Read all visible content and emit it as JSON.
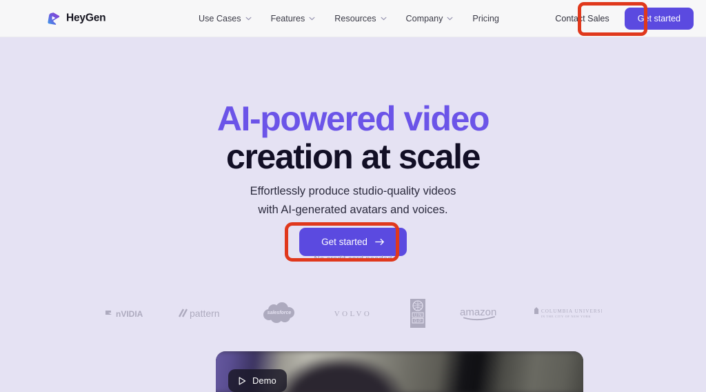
{
  "header": {
    "logo_text": "HeyGen",
    "logo_icon": "heygen-play-logo-icon",
    "nav_items": [
      {
        "label": "Use Cases",
        "has_chevron": true,
        "icon": "chevron-down-icon"
      },
      {
        "label": "Features",
        "has_chevron": true,
        "icon": "chevron-down-icon"
      },
      {
        "label": "Resources",
        "has_chevron": true,
        "icon": "chevron-down-icon"
      },
      {
        "label": "Company",
        "has_chevron": true,
        "icon": "chevron-down-icon"
      },
      {
        "label": "Pricing",
        "has_chevron": false,
        "icon": ""
      }
    ],
    "contact_sales_label": "Contact Sales",
    "cta_label": "Get started"
  },
  "hero": {
    "headline_line1": "AI-powered video",
    "headline_line2": "creation at scale",
    "subhead_line1": "Effortlessly produce studio-quality videos",
    "subhead_line2": "with AI-generated avatars and voices.",
    "cta_label": "Get started",
    "cta_icon": "arrow-right-icon",
    "no_card_note": "No credit card needed"
  },
  "logo_strip": {
    "brands": [
      {
        "name": "nvidia",
        "label": "nVIDIA"
      },
      {
        "name": "pattern",
        "label": "pattern"
      },
      {
        "name": "salesforce",
        "label": "salesforce"
      },
      {
        "name": "volvo",
        "label": "VOLVO"
      },
      {
        "name": "undp",
        "label": "UNDP"
      },
      {
        "name": "amazon",
        "label": "amazon"
      },
      {
        "name": "columbia-university",
        "label": "COLUMBIA UNIVERSITY"
      }
    ]
  },
  "video": {
    "badge_label": "Demo",
    "badge_icon": "play-icon"
  },
  "annotations": {
    "color": "#e0381c",
    "targets": [
      "header-get-started-button",
      "hero-get-started-button"
    ]
  },
  "colors": {
    "accent_purple": "#5b4ae0",
    "headline_purple": "#6b54e8",
    "hero_background": "#e5e2f3",
    "header_background": "#f7f7f8",
    "annotation_red": "#e0381c"
  }
}
